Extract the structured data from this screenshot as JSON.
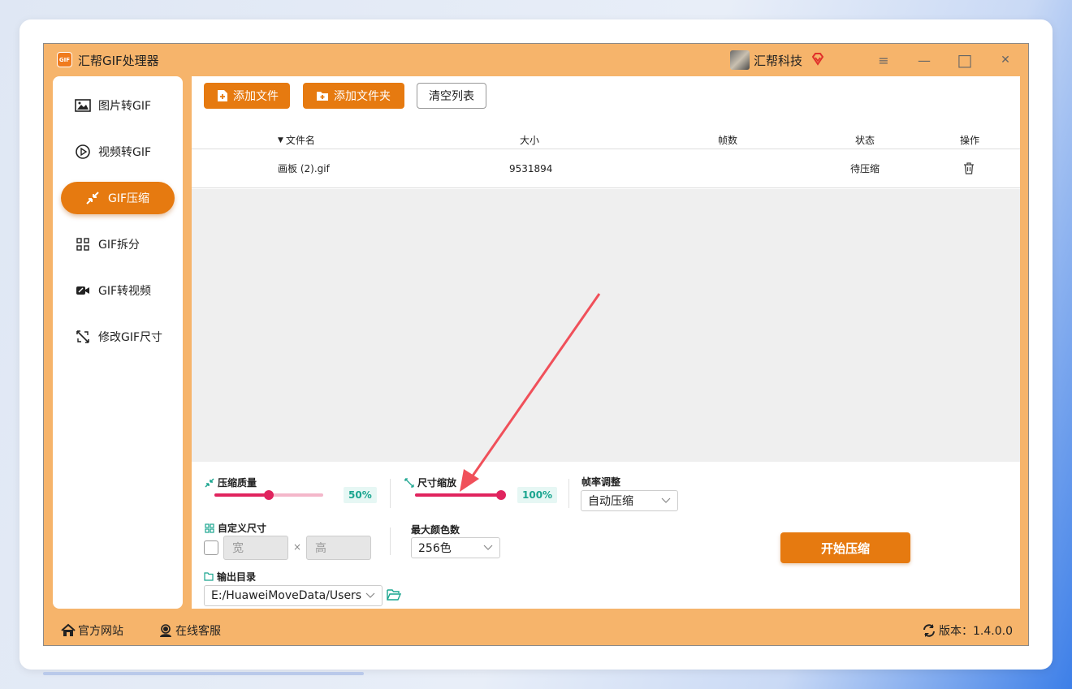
{
  "window": {
    "app_logo_text": "GIF",
    "title": "汇帮GIF处理器",
    "user_name": "汇帮科技",
    "menu_icon": "≡",
    "minimize_icon": "—",
    "maximize_icon": "□",
    "close_icon": "✕"
  },
  "sidebar": {
    "items": [
      {
        "label": "图片转GIF",
        "icon": "image-icon"
      },
      {
        "label": "视频转GIF",
        "icon": "play-icon"
      },
      {
        "label": "GIF压缩",
        "icon": "compress-icon",
        "active": true
      },
      {
        "label": "GIF拆分",
        "icon": "split-icon"
      },
      {
        "label": "GIF转视频",
        "icon": "video-icon"
      },
      {
        "label": "修改GIF尺寸",
        "icon": "resize-icon"
      }
    ]
  },
  "toolbar": {
    "add_file": "添加文件",
    "add_folder": "添加文件夹",
    "clear_list": "清空列表"
  },
  "table": {
    "columns": {
      "name": "文件名",
      "size": "大小",
      "frames": "帧数",
      "status": "状态",
      "actions": "操作"
    },
    "rows": [
      {
        "name": "画板 (2).gif",
        "size": "9531894",
        "frames": "",
        "status": "待压缩"
      }
    ]
  },
  "settings": {
    "quality": {
      "label": "压缩质量",
      "value_text": "50%",
      "value": 0.5
    },
    "scale": {
      "label": "尺寸缩放",
      "value_text": "100%",
      "value": 1.0
    },
    "framerate": {
      "label": "帧率调整",
      "selected": "自动压缩"
    },
    "custom_size": {
      "label": "自定义尺寸",
      "width_placeholder": "宽",
      "height_placeholder": "高",
      "separator": "×"
    },
    "max_colors": {
      "label": "最大颜色数",
      "selected": "256色"
    },
    "output_dir": {
      "label": "输出目录",
      "path": "E:/HuaweiMoveData/Users"
    },
    "start_button": "开始压缩"
  },
  "footer": {
    "website": "官方网站",
    "support": "在线客服",
    "version": "版本：1.4.0.0"
  },
  "colors": {
    "accent": "#e67a10",
    "frame": "#f6b46b",
    "slider": "#e0245e",
    "annotation_arrow": "#f0505a"
  }
}
